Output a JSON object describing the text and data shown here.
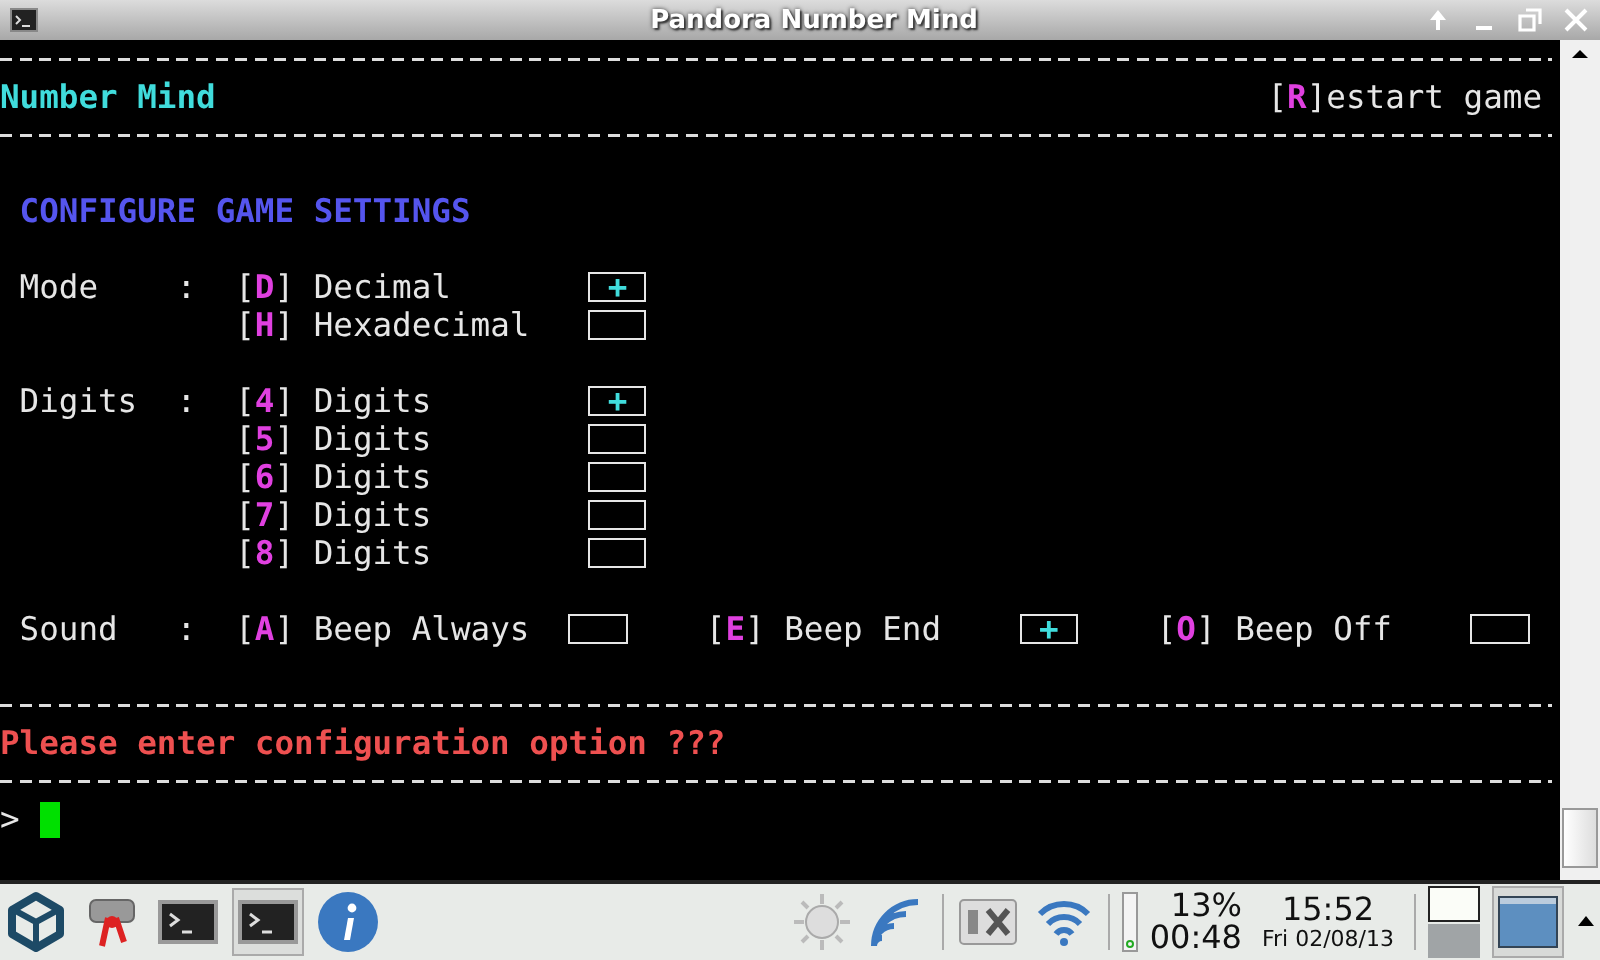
{
  "window": {
    "title": "Pandora Number Mind"
  },
  "terminal": {
    "check_mark": "+",
    "header": {
      "title": "Number Mind",
      "restart_key": "[R]",
      "restart_label": "estart game"
    },
    "heading": "CONFIGURE GAME SETTINGS",
    "settings": [
      {
        "label": "Mode",
        "separator": ":",
        "kind": "column",
        "options": [
          {
            "key": "[D]",
            "label": "Decimal",
            "selected": true
          },
          {
            "key": "[H]",
            "label": "Hexadecimal",
            "selected": false
          }
        ]
      },
      {
        "label": "Digits",
        "separator": ":",
        "kind": "column",
        "options": [
          {
            "key": "[4]",
            "label": "Digits",
            "selected": true
          },
          {
            "key": "[5]",
            "label": "Digits",
            "selected": false
          },
          {
            "key": "[6]",
            "label": "Digits",
            "selected": false
          },
          {
            "key": "[7]",
            "label": "Digits",
            "selected": false
          },
          {
            "key": "[8]",
            "label": "Digits",
            "selected": false
          }
        ]
      },
      {
        "label": "Sound",
        "separator": ":",
        "kind": "row",
        "options": [
          {
            "key": "[A]",
            "label": "Beep Always",
            "selected": false
          },
          {
            "key": "[E]",
            "label": "Beep End",
            "selected": true
          },
          {
            "key": "[O]",
            "label": "Beep Off",
            "selected": false
          }
        ]
      }
    ],
    "message": "Please enter configuration option ???",
    "prompt": ">"
  },
  "taskbar": {
    "battery_percent": "13%",
    "battery_time": "00:48",
    "time": "15:52",
    "date": "Fri 02/08/13"
  }
}
